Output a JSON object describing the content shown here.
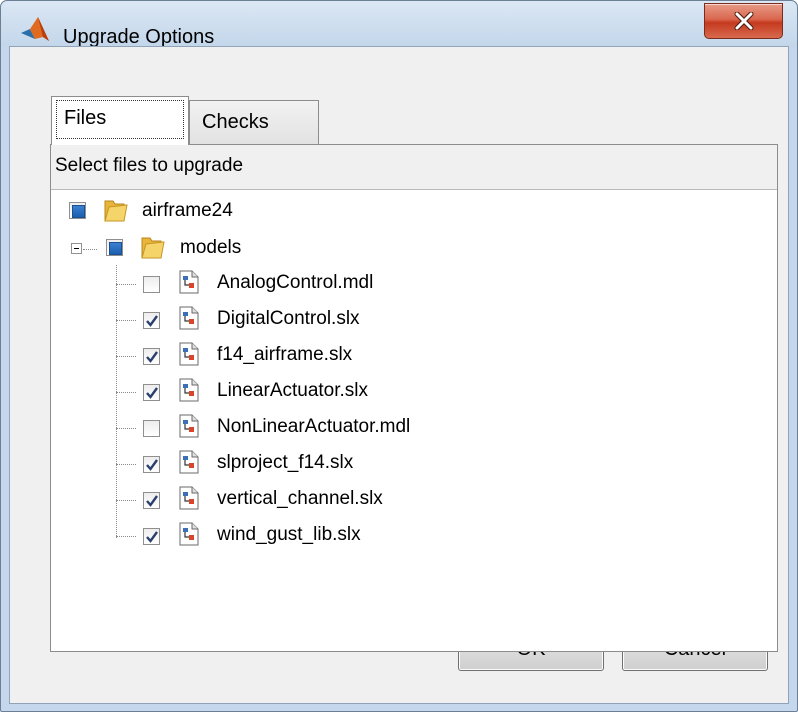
{
  "window": {
    "title": "Upgrade Options"
  },
  "tabs": [
    {
      "label": "Files",
      "active": true
    },
    {
      "label": "Checks",
      "active": false
    }
  ],
  "panel": {
    "header": "Select files to upgrade"
  },
  "tree": {
    "root": {
      "label": "airframe24",
      "state": "partial"
    },
    "folder": {
      "label": "models",
      "state": "partial"
    },
    "files": [
      {
        "label": "AnalogControl.mdl",
        "checked": false
      },
      {
        "label": "DigitalControl.slx",
        "checked": true
      },
      {
        "label": "f14_airframe.slx",
        "checked": true
      },
      {
        "label": "LinearActuator.slx",
        "checked": true
      },
      {
        "label": "NonLinearActuator.mdl",
        "checked": false
      },
      {
        "label": "slproject_f14.slx",
        "checked": true
      },
      {
        "label": "vertical_channel.slx",
        "checked": true
      },
      {
        "label": "wind_gust_lib.slx",
        "checked": true
      }
    ]
  },
  "buttons": {
    "ok": "OK",
    "cancel": "Cancel"
  },
  "colors": {
    "titlebar": "#c4d7ec",
    "close_button": "#c53a1f",
    "checkbox_partial": "#1c5fb0",
    "folder": "#e8b53a"
  }
}
